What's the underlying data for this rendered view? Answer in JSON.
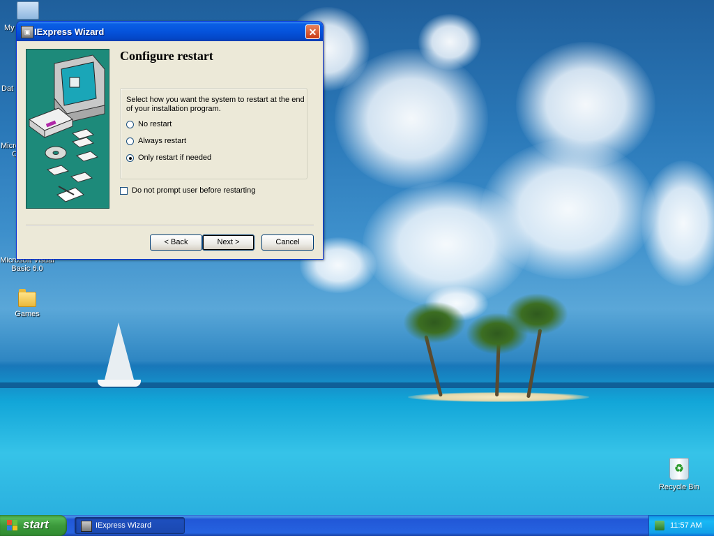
{
  "desktop": {
    "icons": {
      "my_computer": "My",
      "data": "Dat",
      "microsoft": "Micros",
      "microsoft_line2": "C",
      "vb_line1": "Microsoft Visual",
      "vb_line2": "Basic 6.0",
      "games": "Games",
      "recycle_bin": "Recycle Bin"
    }
  },
  "window": {
    "title": "IExpress Wizard",
    "close_glyph": "✕",
    "heading": "Configure restart",
    "instructions": "Select how you want the system to restart at the end of your installation program.",
    "options": [
      {
        "label": "No restart",
        "checked": false
      },
      {
        "label": "Always restart",
        "checked": false
      },
      {
        "label": "Only restart if needed",
        "checked": true
      }
    ],
    "checkbox": {
      "label": "Do not prompt user before restarting",
      "checked": false
    },
    "buttons": {
      "back": "< Back",
      "next": "Next >",
      "cancel": "Cancel"
    }
  },
  "taskbar": {
    "start_label": "start",
    "task_label": "IExpress Wizard",
    "clock": "11:57 AM"
  },
  "colors": {
    "titlebar": "#0553dc",
    "start_button": "#3c9a3c",
    "taskbar": "#2663e0",
    "wizard_art": "#1d8a7a"
  }
}
